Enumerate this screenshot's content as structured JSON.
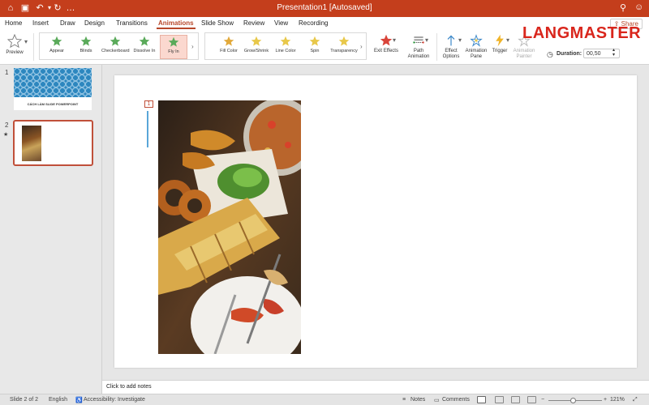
{
  "title_bar": {
    "title": "Presentation1 [Autosaved]",
    "quick_access": [
      "home-icon",
      "save-icon",
      "undo-icon",
      "undo-dropdown-icon",
      "redo-icon",
      "more-icon"
    ]
  },
  "tabs": [
    "Home",
    "Insert",
    "Draw",
    "Design",
    "Transitions",
    "Animations",
    "Slide Show",
    "Review",
    "View",
    "Recording"
  ],
  "active_tab": "Animations",
  "share_label": "Share",
  "ribbon": {
    "preview": "Preview",
    "effects": [
      {
        "label": "Appear",
        "color": "#5aaa5a"
      },
      {
        "label": "Blinds",
        "color": "#5aaa5a"
      },
      {
        "label": "Checkerboard",
        "color": "#5aaa5a"
      },
      {
        "label": "Dissolve In",
        "color": "#5aaa5a"
      },
      {
        "label": "Fly In",
        "color": "#5aaa5a",
        "selected": true
      }
    ],
    "emphasis": [
      {
        "label": "Fill Color",
        "color": "#e2a93a"
      },
      {
        "label": "Grow/Shrink",
        "color": "#e8c84a"
      },
      {
        "label": "Line Color",
        "color": "#e8c84a"
      },
      {
        "label": "Spin",
        "color": "#e8c84a"
      },
      {
        "label": "Transparency",
        "color": "#e8c84a"
      }
    ],
    "exit_effects": "Exit Effects",
    "path_animation": "Path Animation",
    "effect_options": "Effect Options",
    "animation_pane": "Animation Pane",
    "trigger": "Trigger",
    "animation_painter": "Animation Painter",
    "duration_label": "Duration:",
    "duration_value": "00,50"
  },
  "brand": "LANGMASTER",
  "slides": [
    {
      "number": "1",
      "caption": "CÁCH LÀM SLIDE POWERPOINT"
    },
    {
      "number": "2",
      "has_animation": true
    }
  ],
  "animation_tag": "1",
  "notes_placeholder": "Click to add notes",
  "status": {
    "slide_counter": "Slide 2 of 2",
    "language": "English",
    "accessibility": "Accessibility: Investigate",
    "notes": "Notes",
    "comments": "Comments",
    "zoom": "121%",
    "zoom_level_fraction": 0.45
  },
  "colors": {
    "accent": "#c43e1c",
    "brand": "#d9261c",
    "selection": "#fbd8cf"
  }
}
